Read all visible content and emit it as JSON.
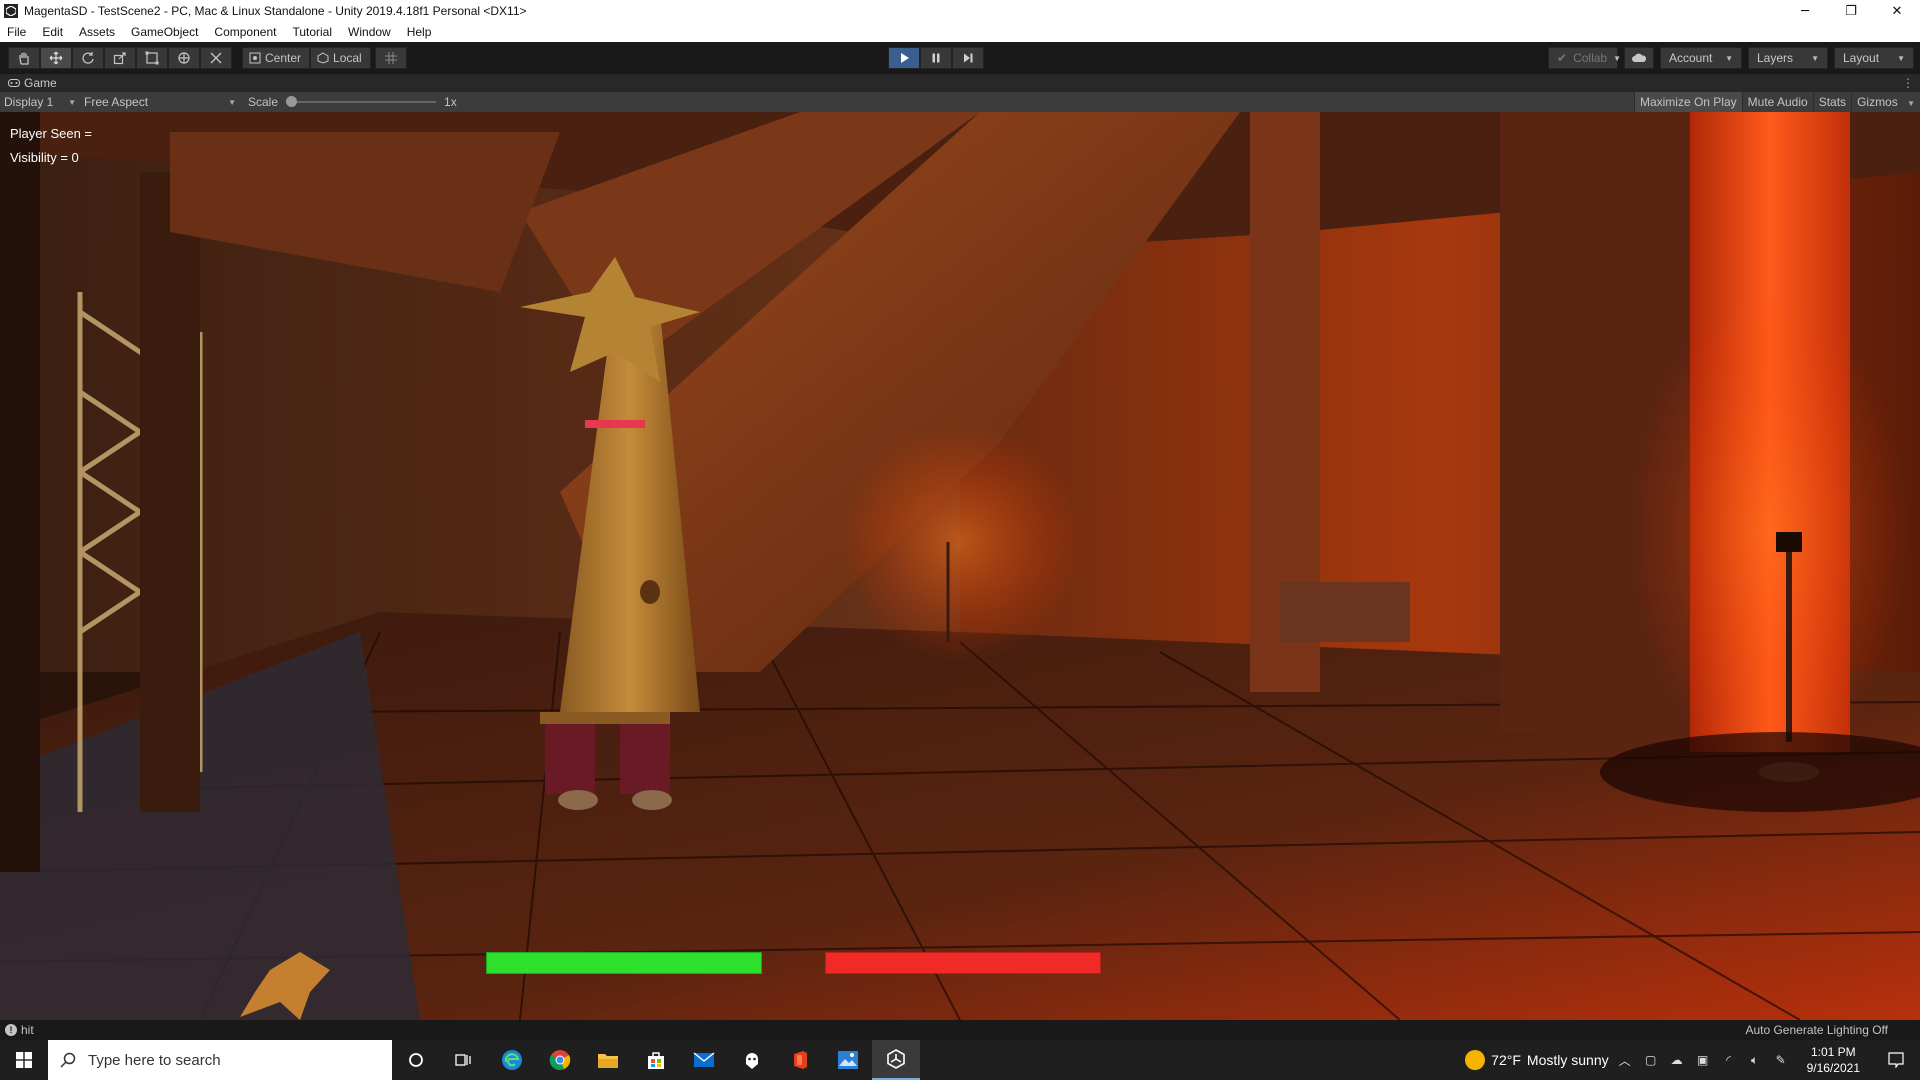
{
  "window": {
    "title": "MagentaSD - TestScene2 - PC, Mac & Linux Standalone - Unity 2019.4.18f1 Personal <DX11>",
    "minimize": "─",
    "restore": "❐",
    "close": "✕"
  },
  "menu": [
    "File",
    "Edit",
    "Assets",
    "GameObject",
    "Component",
    "Tutorial",
    "Window",
    "Help"
  ],
  "toolbar": {
    "pivot_label": "Center",
    "space_label": "Local",
    "collab_label": "Collab",
    "account_label": "Account",
    "layers_label": "Layers",
    "layout_label": "Layout"
  },
  "game_tab": {
    "label": "Game",
    "display": "Display 1",
    "aspect": "Free Aspect",
    "scale_label": "Scale",
    "scale_value": "1x",
    "scale_level": 0,
    "maximize_on_play": "Maximize On Play",
    "mute_audio": "Mute Audio",
    "stats": "Stats",
    "gizmos": "Gizmos"
  },
  "hud": {
    "player_seen": "Player Seen =",
    "visibility": "Visibility = 0",
    "green_bar_level": 1.0,
    "red_bar_level": 1.0,
    "green_color": "#2ce02b",
    "red_color": "#ef2a27"
  },
  "status": {
    "message": "hit",
    "right_text": "Auto Generate Lighting Off"
  },
  "taskbar": {
    "search_placeholder": "Type here to search",
    "weather_temp": "72°F",
    "weather_desc": "Mostly sunny",
    "time": "1:01 PM",
    "date": "9/16/2021"
  },
  "colors": {
    "toolbar_bg": "#191919",
    "play_active": "#3a5f8e",
    "accent_orange": "#ff4a10"
  }
}
